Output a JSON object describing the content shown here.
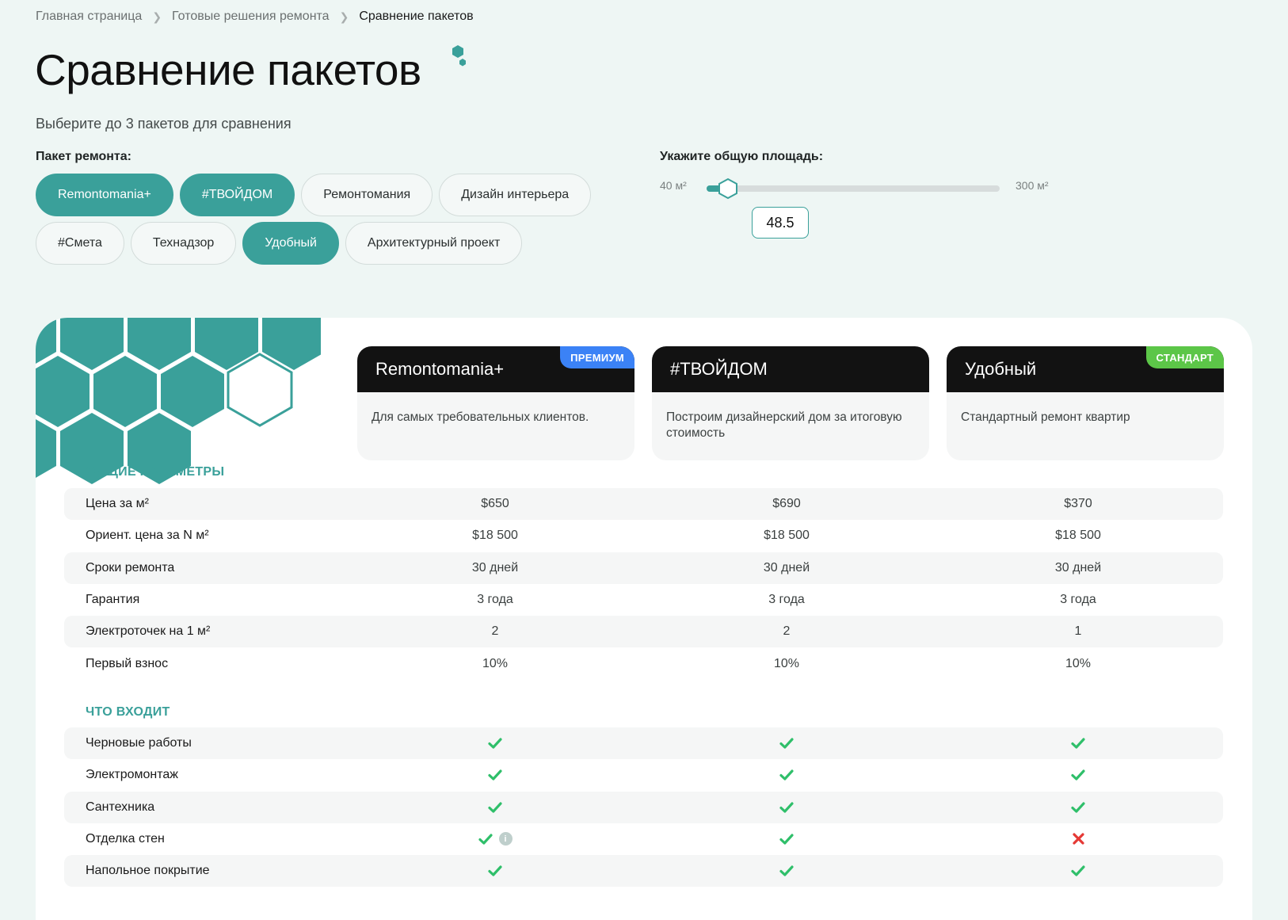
{
  "breadcrumb": {
    "home": "Главная страница",
    "section": "Готовые решения ремонта",
    "current": "Сравнение пакетов"
  },
  "page": {
    "title": "Сравнение пакетов",
    "subtitle": "Выберите до 3 пакетов для сравнения"
  },
  "filters": {
    "package_label": "Пакет ремонта:",
    "chips": [
      {
        "label": "Remontomania+",
        "active": true
      },
      {
        "label": "#ТВОЙДОМ",
        "active": true
      },
      {
        "label": "Ремонтомания",
        "active": false
      },
      {
        "label": "Дизайн интерьера",
        "active": false
      },
      {
        "label": "#Смета",
        "active": false
      },
      {
        "label": "Технадзор",
        "active": false
      },
      {
        "label": "Удобный",
        "active": true
      },
      {
        "label": "Архитектурный проект",
        "active": false
      }
    ],
    "area": {
      "label": "Укажите общую площадь:",
      "min_label": "40 м²",
      "max_label": "300 м²",
      "min": 40,
      "max": 300,
      "value": 48.5,
      "input_value": "48.5"
    }
  },
  "colors": {
    "accent": "#3aa09a",
    "premium_badge": "#3b82f6",
    "standard_badge": "#5cc648",
    "check": "#2fbf6a",
    "cross": "#e53935"
  },
  "packages": [
    {
      "name": "Remontomania+",
      "desc": "Для самых требовательных клиентов.",
      "badge": "ПРЕМИУМ",
      "badge_color": "#3b82f6"
    },
    {
      "name": "#ТВОЙДОМ",
      "desc": "Построим дизайнерский дом за итоговую стоимость",
      "badge": "",
      "badge_color": ""
    },
    {
      "name": "Удобный",
      "desc": "Стандартный ремонт квартир",
      "badge": "СТАНДАРТ",
      "badge_color": "#5cc648"
    }
  ],
  "sections": [
    {
      "title": "ОБЩИЕ ПАРАМЕТРЫ",
      "rows": [
        {
          "label": "Цена за м²",
          "values": [
            "$650",
            "$690",
            "$370"
          ]
        },
        {
          "label": "Ориент. цена за N м²",
          "values": [
            "$18 500",
            "$18 500",
            "$18 500"
          ]
        },
        {
          "label": "Сроки ремонта",
          "values": [
            "30 дней",
            "30 дней",
            "30 дней"
          ]
        },
        {
          "label": "Гарантия",
          "values": [
            "3 года",
            "3 года",
            "3 года"
          ]
        },
        {
          "label": "Электроточек на 1 м²",
          "values": [
            "2",
            "2",
            "1"
          ]
        },
        {
          "label": "Первый взнос",
          "values": [
            "10%",
            "10%",
            "10%"
          ]
        }
      ]
    },
    {
      "title": "ЧТО ВХОДИТ",
      "rows": [
        {
          "label": "Черновые работы",
          "values": [
            "check",
            "check",
            "check"
          ]
        },
        {
          "label": "Электромонтаж",
          "values": [
            "check",
            "check",
            "check"
          ]
        },
        {
          "label": "Сантехника",
          "values": [
            "check",
            "check",
            "check"
          ]
        },
        {
          "label": "Отделка стен",
          "values": [
            "check",
            "check",
            "cross"
          ],
          "info": [
            true,
            false,
            false
          ],
          "info_text": "i"
        },
        {
          "label": "Напольное покрытие",
          "values": [
            "check",
            "check",
            "check"
          ]
        }
      ]
    }
  ]
}
